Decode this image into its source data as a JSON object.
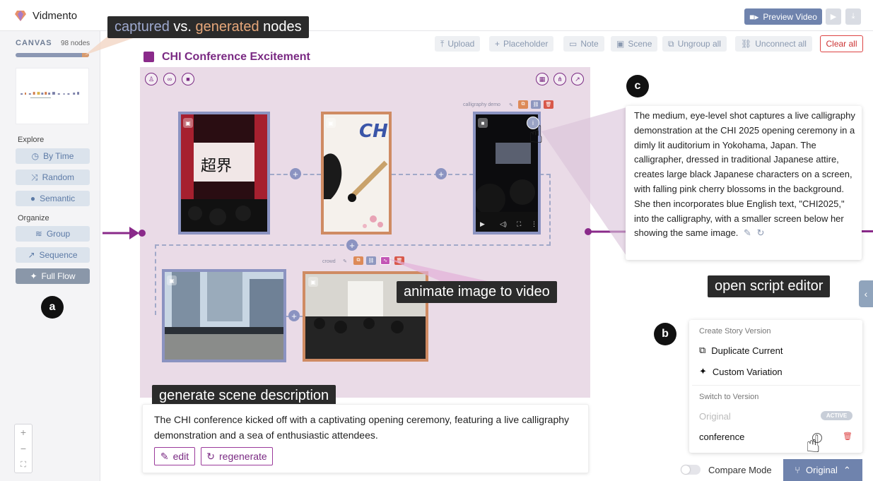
{
  "app": {
    "title": "Vidmento"
  },
  "header": {
    "preview_label": "Preview Video",
    "play_icon": "play-icon",
    "download_icon": "download-icon",
    "accent": "#6f83ad"
  },
  "sidebar": {
    "canvas_label": "CANVAS",
    "node_count": "98 nodes",
    "explore_label": "Explore",
    "organize_label": "Organize",
    "explore_items": [
      "By Time",
      "Random",
      "Semantic"
    ],
    "organize_items": [
      "Group",
      "Sequence",
      "Full Flow"
    ],
    "active_item": "Full Flow",
    "zoom": [
      "+",
      "−",
      "⛶"
    ]
  },
  "annotations": {
    "captured_word": "captured",
    "vs_word": " vs. ",
    "generated_word": "generated",
    "nodes_word": " nodes",
    "animate": "animate image to video",
    "generate_scene": "generate scene description",
    "open_script": "open script editor",
    "a": "a",
    "b": "b",
    "c": "c",
    "captured_color": "#9ea9cf",
    "generated_color": "#e7a77a"
  },
  "toolbar": {
    "upload": "Upload",
    "placeholder": "Placeholder",
    "note": "Note",
    "scene": "Scene",
    "ungroup": "Ungroup all",
    "unconnect": "Unconnect all",
    "clear": "Clear all"
  },
  "scene": {
    "title": "CHI Conference Excitement",
    "calligraphy_label": "calligraphy demo",
    "crowd_label": "crowd",
    "color": "#7a2a83",
    "bg": "#eadbe7"
  },
  "description": {
    "text": "The CHI conference kicked off with a captivating opening ceremony, featuring a live calligraphy demonstration and a sea of enthusiastic attendees.",
    "edit": "edit",
    "regenerate": "regenerate"
  },
  "script": {
    "text": "The medium, eye-level shot captures a live calligraphy demonstration at the CHI 2025 opening ceremony in a dimly lit auditorium in Yokohama, Japan. The calligrapher, dressed in traditional Japanese attire, creates large black Japanese characters on a screen, with falling pink cherry blossoms in the background. She then incorporates blue English text, \"CHI2025,\" into the calligraphy, with a smaller screen below her showing the same image."
  },
  "versions": {
    "create_header": "Create Story Version",
    "duplicate": "Duplicate Current",
    "custom": "Custom Variation",
    "switch_header": "Switch to Version",
    "original": "Original",
    "active": "ACTIVE",
    "conference": "conference",
    "compare_mode": "Compare Mode",
    "current": "Original"
  }
}
